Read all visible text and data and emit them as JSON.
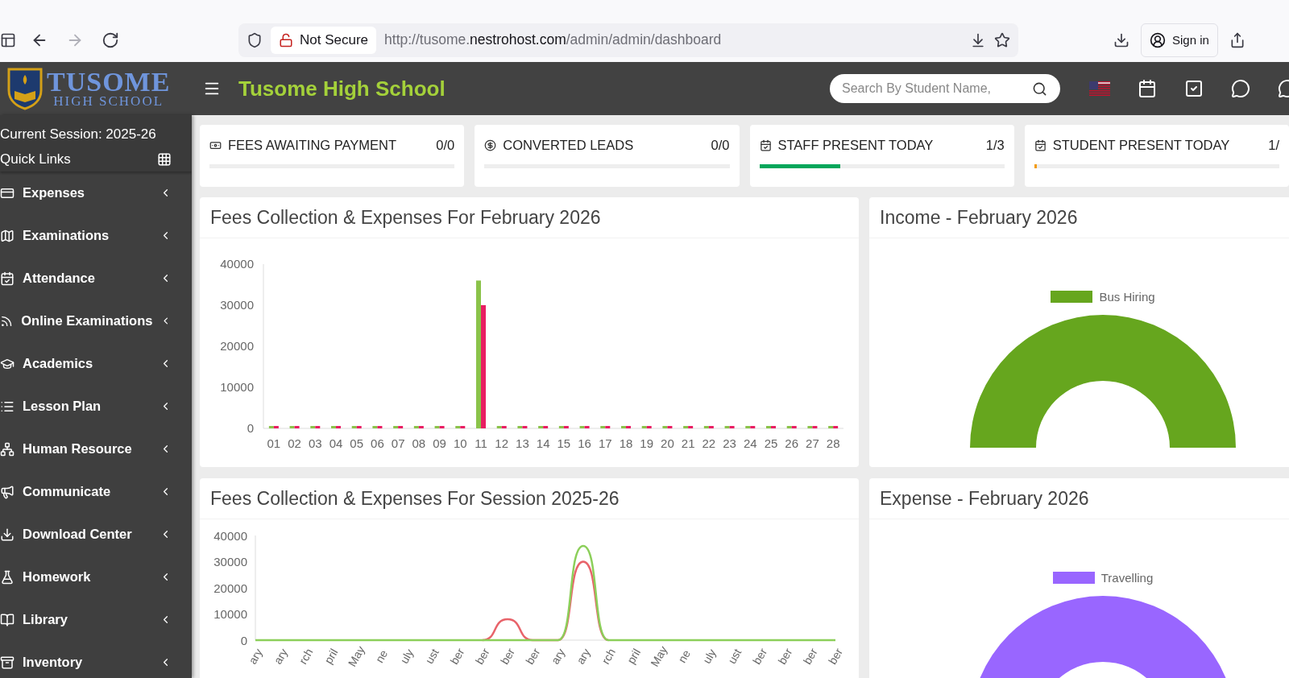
{
  "browser": {
    "nav_buttons": [
      {
        "kind": "back",
        "disabled": false
      },
      {
        "kind": "forward",
        "disabled": true
      },
      {
        "kind": "reload",
        "disabled": false
      }
    ],
    "security": "Not Secure",
    "url": "http://tusome.**nestrohost.com**/admin/admin/dashboard",
    "sign_in": "Sign in"
  },
  "header": {
    "logo_name": "TUSOME",
    "logo_tagline": "HIGH SCHOOL",
    "title": "Tusome High School",
    "search": {
      "placeholder": "Search By Student Name,"
    }
  },
  "sidebar": {
    "session": "Current Session: 2025-26",
    "quick_links": "Quick Links",
    "items": [
      {
        "kind": "expenses",
        "label": "Expenses",
        "expanded": false
      },
      {
        "kind": "examinations",
        "label": "Examinations",
        "expanded": false
      },
      {
        "kind": "attendance",
        "label": "Attendance",
        "expanded": false
      },
      {
        "kind": "online",
        "label": "Online Examinations",
        "expanded": false
      },
      {
        "kind": "academics",
        "label": "Academics",
        "expanded": false
      },
      {
        "kind": "lesson",
        "label": "Lesson Plan",
        "expanded": false
      },
      {
        "kind": "hr",
        "label": "Human Resource",
        "expanded": false
      },
      {
        "kind": "communicate",
        "label": "Communicate",
        "expanded": false
      },
      {
        "kind": "download",
        "label": "Download Center",
        "expanded": false
      },
      {
        "kind": "homework",
        "label": "Homework",
        "expanded": false
      },
      {
        "kind": "library",
        "label": "Library",
        "expanded": false
      },
      {
        "kind": "inventory",
        "label": "Inventory",
        "expanded": false
      }
    ]
  },
  "stats": [
    {
      "kind": "money",
      "label": "FEES AWAITING PAYMENT",
      "value": "0/0"
    },
    {
      "kind": "leads",
      "label": "CONVERTED LEADS",
      "value": "0/0"
    },
    {
      "kind": "calendar",
      "label": "STAFF PRESENT TODAY",
      "value": "1/3",
      "level": 0.33,
      "color": "#00a65a"
    },
    {
      "kind": "calendar",
      "label": "STUDENT PRESENT TODAY",
      "value": "1/",
      "level": 0.01,
      "color": "#f39c12"
    }
  ],
  "fees_month": {
    "title": "Fees Collection & Expenses For February 2026",
    "chart_data": {
      "type": "bar",
      "categories": [
        "01",
        "02",
        "03",
        "04",
        "05",
        "06",
        "07",
        "08",
        "09",
        "10",
        "11",
        "12",
        "13",
        "14",
        "15",
        "16",
        "17",
        "18",
        "19",
        "20",
        "21",
        "22",
        "23",
        "24",
        "25",
        "26",
        "27",
        "28"
      ],
      "series": [
        {
          "color": "#8bc34a",
          "values": [
            0,
            0,
            0,
            0,
            0,
            0,
            0,
            0,
            0,
            0,
            36000,
            0,
            0,
            0,
            0,
            0,
            0,
            0,
            0,
            0,
            0,
            0,
            0,
            0,
            0,
            0,
            0,
            0
          ]
        },
        {
          "color": "#e91e63",
          "values": [
            0,
            0,
            0,
            0,
            0,
            0,
            0,
            0,
            0,
            0,
            30000,
            0,
            0,
            0,
            0,
            0,
            0,
            0,
            0,
            0,
            0,
            0,
            0,
            0,
            0,
            0,
            0,
            0
          ]
        }
      ],
      "ylim": [
        0,
        40000
      ],
      "yticks": [
        0,
        10000,
        20000,
        30000,
        40000
      ]
    }
  },
  "income": {
    "title": "Income - February 2026",
    "legend": [
      {
        "label": "Bus Hiring",
        "color": "#66a61e"
      }
    ]
  },
  "fees_session": {
    "title": "Fees Collection & Expenses For Session 2025-26",
    "chart_data": {
      "type": "line",
      "categories": [
        "ary",
        "ary",
        "rch",
        "pril",
        "May",
        "ne",
        "uly",
        "ust",
        "ber",
        "ber",
        "ber",
        "ber",
        "ary",
        "ary",
        "rch",
        "pril",
        "May",
        "ne",
        "uly",
        "ust",
        "ber",
        "ber",
        "ber",
        "ber"
      ],
      "series": [
        {
          "color": "#e8636a",
          "values": [
            null,
            null,
            null,
            null,
            null,
            null,
            null,
            null,
            null,
            0,
            8000,
            0,
            0,
            30000,
            0,
            null,
            null,
            null,
            null,
            null,
            null,
            null,
            null,
            null
          ]
        },
        {
          "color": "#8ccf5a",
          "values": [
            0,
            0,
            0,
            0,
            0,
            0,
            0,
            0,
            0,
            0,
            0,
            0,
            0,
            36000,
            0,
            0,
            0,
            0,
            0,
            0,
            0,
            0,
            0,
            0
          ]
        }
      ],
      "ylim": [
        0,
        40000
      ],
      "yticks": [
        0,
        10000,
        20000,
        30000,
        40000
      ]
    }
  },
  "expense": {
    "title": "Expense - February 2026",
    "legend": [
      {
        "label": "Travelling",
        "color": "#9966ff"
      }
    ]
  }
}
